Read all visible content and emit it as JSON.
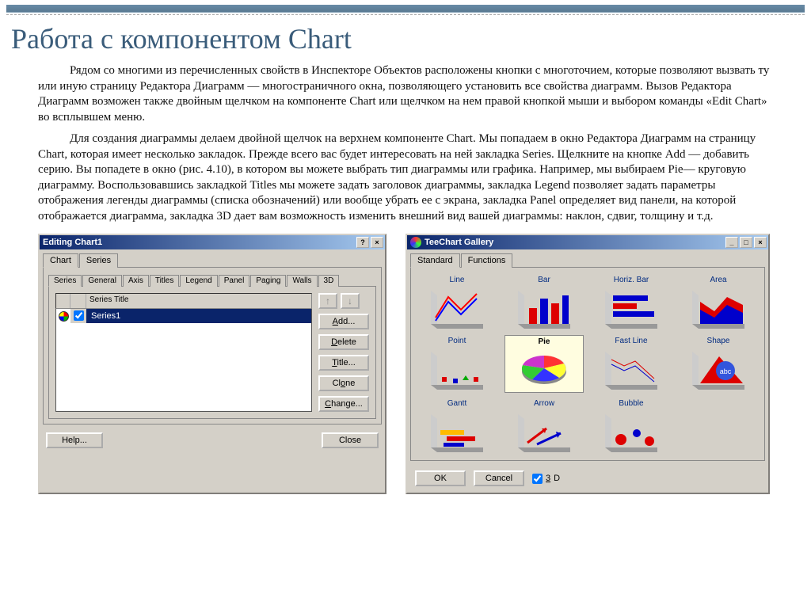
{
  "page_title": "Работа с компонентом Chart",
  "paragraph1": "Рядом со многими из перечисленных свойств в Инспекторе Объектов расположены кнопки с многоточием, которые позволяют вызвать ту или иную страницу Редактора Диаграмм — многостраничного окна, позволяющего установить все свойства диаграмм. Вызов Редактора Диаграмм возможен также двойным щелчком на компоненте Chart или щелчком на нем правой кнопкой мыши и выбором команды «Edit Chart» во всплывшем меню.",
  "paragraph2": "Для создания диаграммы делаем двойной щелчок на верхнем компоненте Chart. Мы попадаем в окно Редактора Диаграмм на страницу Chart, которая имеет несколько закладок. Прежде всего вас будет интересовать на ней закладка Series. Щелкните на кнопке Add — добавить серию. Вы попадете в окно (рис. 4.10), в котором вы можете выбрать тип диаграммы или графика. Например, мы выбираем Pie— круговую диаграмму. Воспользовавшись закладкой Titles мы можете задать заголовок диаграммы, закладка Legend позволяет задать параметры отображения легенды диаграммы (списка обозначений) или вообще убрать ее с экрана, закладка Panel определяет вид панели, на которой отображается диаграмма, закладка 3D дает вам возможность изменить внешний вид вашей диаграммы: наклон, сдвиг, толщину и т.д.",
  "win1": {
    "title": "Editing Chart1",
    "outer_tabs": [
      "Chart",
      "Series"
    ],
    "inner_tabs": [
      "Series",
      "General",
      "Axis",
      "Titles",
      "Legend",
      "Panel",
      "Paging",
      "Walls",
      "3D"
    ],
    "series_header": "Series Title",
    "series_row": "Series1",
    "buttons": {
      "add": "Add...",
      "delete": "Delete",
      "title": "Title...",
      "clone": "Clone",
      "change": "Change..."
    },
    "help": "Help...",
    "close": "Close"
  },
  "win2": {
    "title": "TeeChart Gallery",
    "tabs": [
      "Standard",
      "Functions"
    ],
    "items": [
      "Line",
      "Bar",
      "Horiz. Bar",
      "Area",
      "Point",
      "Pie",
      "Fast Line",
      "Shape",
      "Gantt",
      "Arrow",
      "Bubble"
    ],
    "ok": "OK",
    "cancel": "Cancel",
    "chk3d": "3D"
  }
}
